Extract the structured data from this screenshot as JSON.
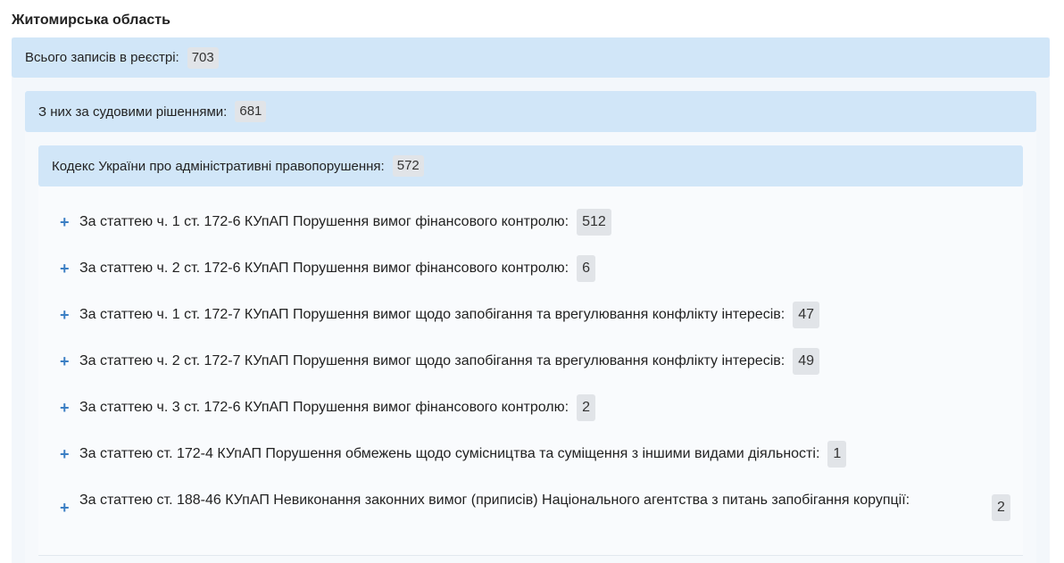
{
  "region": {
    "title": "Житомирська область"
  },
  "total": {
    "label": "Всього записів в реєстрі:",
    "count": "703"
  },
  "court": {
    "label": "З них за судовими рішеннями:",
    "count": "681"
  },
  "code": {
    "label": "Кодекс України про адміністративні правопорушення:",
    "count": "572"
  },
  "items": [
    {
      "text": "За статтею ч. 1 ст. 172-6 КУпАП Порушення вимог фінансового контролю:",
      "count": "512"
    },
    {
      "text": "За статтею ч. 2 ст. 172-6 КУпАП Порушення вимог фінансового контролю:",
      "count": "6"
    },
    {
      "text": "За статтею ч. 1 ст. 172-7 КУпАП Порушення вимог щодо запобігання та врегулювання конфлікту інтересів:",
      "count": "47"
    },
    {
      "text": "За статтею ч. 2 ст. 172-7 КУпАП Порушення вимог щодо запобігання та врегулювання конфлікту інтересів:",
      "count": "49"
    },
    {
      "text": "За статтею ч. 3 ст. 172-6 КУпАП Порушення вимог фінансового контролю:",
      "count": "2"
    },
    {
      "text": "За статтею ст. 172-4 КУпАП Порушення обмежень щодо сумісництва та суміщення з іншими видами діяльності:",
      "count": "1"
    },
    {
      "text": "За статтею ст. 188-46 КУпАП Невиконання законних вимог (приписів) Національного агентства з питань запобігання корупції:",
      "count": "2"
    }
  ],
  "icons": {
    "expand": "plus-icon"
  },
  "colors": {
    "header_bg": "#d1e6f8",
    "plus": "#3b7fc4",
    "badge_bg": "#e1e4e8"
  }
}
